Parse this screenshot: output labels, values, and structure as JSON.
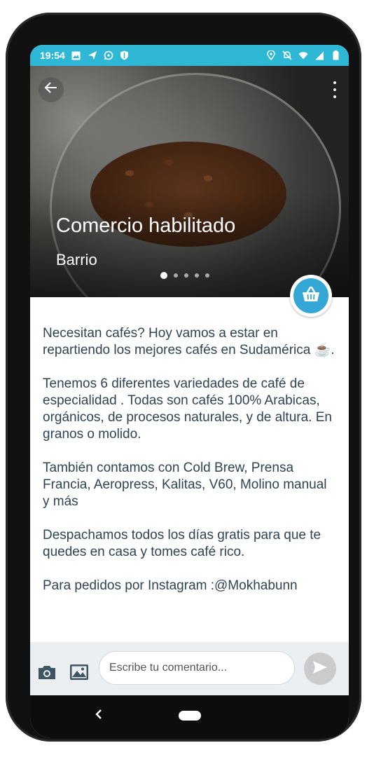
{
  "status_bar": {
    "time": "19:54",
    "left_icons": [
      "gallery-icon",
      "send-icon",
      "whatsapp-icon",
      "shield-icon"
    ],
    "right_icons": [
      "location-icon",
      "mute-icon",
      "wifi-icon",
      "signal-icon",
      "battery-icon"
    ]
  },
  "hero": {
    "title": "Comercio habilitado",
    "subtitle": "Barrio",
    "carousel_total": 5,
    "carousel_active": 1
  },
  "description": {
    "paragraphs": [
      "Necesitan cafés? Hoy vamos a estar en repartiendo los mejores cafés en Sudamérica ☕.",
      "Tenemos 6 diferentes variedades de café de especialidad . Todas son cafés 100% Arabicas, orgánicos, de procesos naturales, y de altura. En granos o molido.",
      "También contamos con Cold Brew, Prensa Francia, Aeropress, Kalitas, V60, Molino manual y más",
      "Despachamos todos los días gratis para que te quedes en casa y tomes café rico.",
      "Para pedidos por Instagram :@Mokhabunn"
    ]
  },
  "comment": {
    "placeholder": "Escribe tu comentario..."
  },
  "colors": {
    "status_bar": "#2fb8d6",
    "cart_button": "#34a7d6",
    "text": "#2f4453",
    "send_button": "#c9cbcc"
  }
}
